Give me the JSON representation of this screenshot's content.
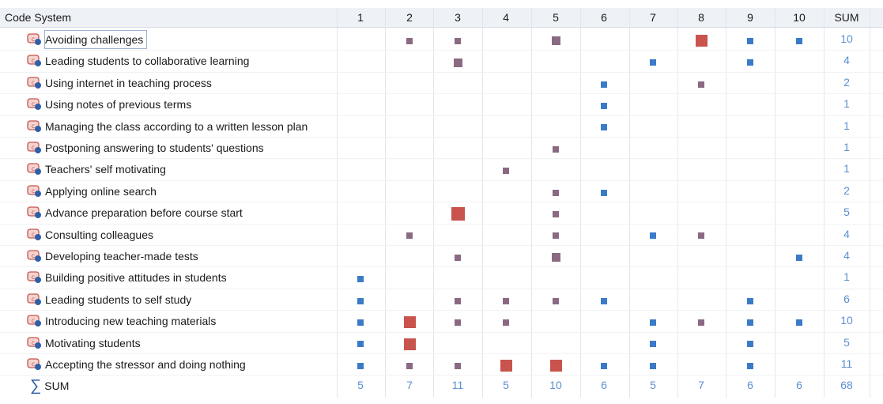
{
  "header": {
    "title": "Code System",
    "columns": [
      "1",
      "2",
      "3",
      "4",
      "5",
      "6",
      "7",
      "8",
      "9",
      "10"
    ],
    "sum_label": "SUM"
  },
  "colors": {
    "small_square": "#3a7bc8",
    "medium_square": "#8a6a82",
    "large_square": "#c8544d",
    "sum_text": "#5b8fd0"
  },
  "rows": [
    {
      "name": "Avoiding challenges",
      "sum": "10",
      "selected": true,
      "cells": [
        0,
        1,
        1,
        0,
        2,
        0,
        0,
        3,
        1,
        1
      ]
    },
    {
      "name": "Leading students to collaborative learning",
      "sum": "4",
      "cells": [
        0,
        0,
        2,
        0,
        0,
        0,
        1,
        0,
        1,
        0
      ]
    },
    {
      "name": "Using internet in teaching process",
      "sum": "2",
      "cells": [
        0,
        0,
        0,
        0,
        0,
        1,
        0,
        1,
        0,
        0
      ]
    },
    {
      "name": "Using notes of previous terms",
      "sum": "1",
      "cells": [
        0,
        0,
        0,
        0,
        0,
        1,
        0,
        0,
        0,
        0
      ]
    },
    {
      "name": "Managing the class according to a written lesson plan",
      "sum": "1",
      "cells": [
        0,
        0,
        0,
        0,
        0,
        1,
        0,
        0,
        0,
        0
      ]
    },
    {
      "name": "Postponing answering to students' questions",
      "sum": "1",
      "cells": [
        0,
        0,
        0,
        0,
        1,
        0,
        0,
        0,
        0,
        0
      ]
    },
    {
      "name": "Teachers' self motivating",
      "sum": "1",
      "cells": [
        0,
        0,
        0,
        1,
        0,
        0,
        0,
        0,
        0,
        0
      ]
    },
    {
      "name": "Applying online search",
      "sum": "2",
      "cells": [
        0,
        0,
        0,
        0,
        1,
        1,
        0,
        0,
        0,
        0
      ]
    },
    {
      "name": "Advance preparation before course start",
      "sum": "5",
      "cells": [
        0,
        0,
        4,
        0,
        1,
        0,
        0,
        0,
        0,
        0
      ]
    },
    {
      "name": "Consulting colleagues",
      "sum": "4",
      "cells": [
        0,
        1,
        0,
        0,
        1,
        0,
        1,
        1,
        0,
        0
      ]
    },
    {
      "name": "Developing teacher-made tests",
      "sum": "4",
      "cells": [
        0,
        0,
        1,
        0,
        2,
        0,
        0,
        0,
        0,
        1
      ]
    },
    {
      "name": "Building positive attitudes in students",
      "sum": "1",
      "cells": [
        1,
        0,
        0,
        0,
        0,
        0,
        0,
        0,
        0,
        0
      ]
    },
    {
      "name": "Leading students to self study",
      "sum": "6",
      "cells": [
        1,
        0,
        1,
        1,
        1,
        1,
        0,
        0,
        1,
        0
      ]
    },
    {
      "name": "Introducing new teaching materials",
      "sum": "10",
      "cells": [
        1,
        3,
        1,
        1,
        0,
        0,
        1,
        1,
        1,
        1
      ]
    },
    {
      "name": "Motivating students",
      "sum": "5",
      "cells": [
        1,
        3,
        0,
        0,
        0,
        0,
        1,
        0,
        1,
        0
      ]
    },
    {
      "name": "Accepting the stressor and doing nothing",
      "sum": "11",
      "cells": [
        1,
        1,
        1,
        3,
        3,
        1,
        1,
        0,
        1,
        0
      ]
    }
  ],
  "sum_row": {
    "label": "SUM",
    "values": [
      "5",
      "7",
      "11",
      "5",
      "10",
      "6",
      "5",
      "7",
      "6",
      "6"
    ],
    "total": "68"
  }
}
